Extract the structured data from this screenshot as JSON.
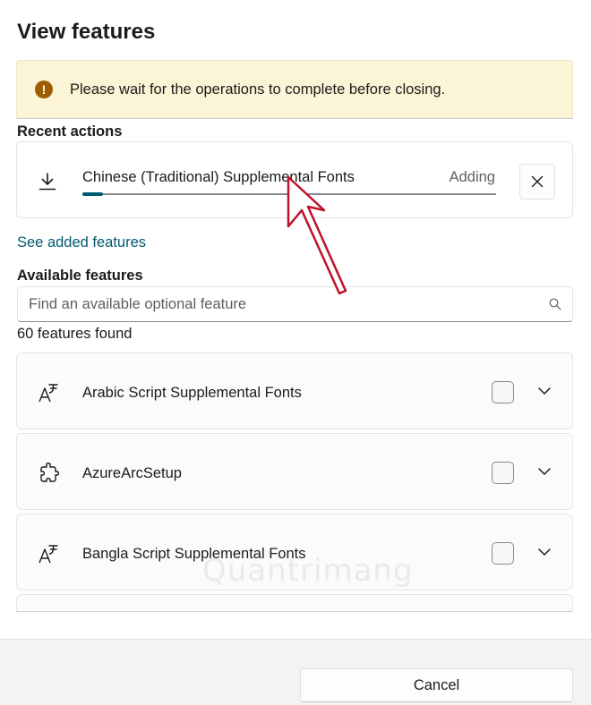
{
  "dialog": {
    "title": "View features",
    "warning": {
      "icon": "warning-icon",
      "icon_glyph": "!",
      "text": "Please wait for the operations to complete before closing.",
      "color": "#9d5d00"
    },
    "recent_actions": {
      "label": "Recent actions",
      "item": {
        "icon": "download-icon",
        "name": "Chinese (Traditional) Supplemental Fonts",
        "status": "Adding",
        "progress_percent": 5,
        "close_icon": "close-icon"
      }
    },
    "see_added_link": "See added features",
    "available": {
      "label": "Available features",
      "search_placeholder": "Find an available optional feature",
      "count_text": "60 features found",
      "items": [
        {
          "name": "Arabic Script Supplemental Fonts",
          "icon": "font-icon",
          "checked": false
        },
        {
          "name": "AzureArcSetup",
          "icon": "puzzle-icon",
          "checked": false
        },
        {
          "name": "Bangla Script Supplemental Fonts",
          "icon": "font-icon",
          "checked": false
        }
      ]
    },
    "footer": {
      "cancel_label": "Cancel"
    }
  },
  "watermark": "Quantrimang",
  "colors": {
    "accent": "#005a70",
    "warning_bg": "#fcf4d6",
    "annotation": "#c0102a"
  }
}
